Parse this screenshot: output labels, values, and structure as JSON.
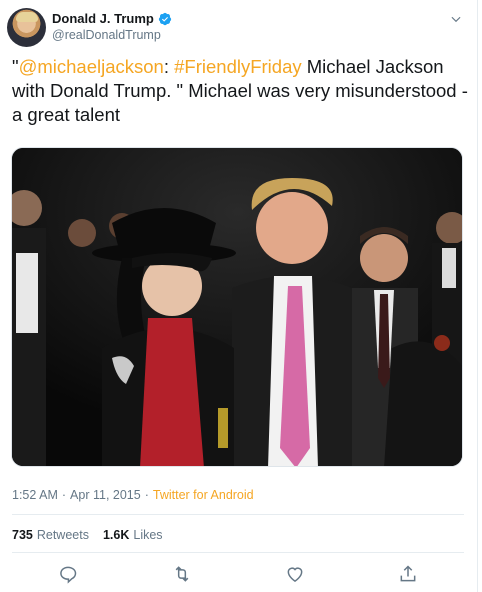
{
  "author": {
    "display_name": "Donald J. Trump",
    "handle": "@realDonaldTrump",
    "verified": true
  },
  "tweet": {
    "prefix": "\"",
    "mention": "@michaeljackson",
    "colon": ": ",
    "hashtag": "#FriendlyFriday",
    "body": " Michael Jackson with Donald Trump. \" Michael was very misunderstood - a great talent"
  },
  "meta": {
    "time": "1:52 AM",
    "separator": "·",
    "date": "Apr 11, 2015",
    "source": "Twitter for Android"
  },
  "stats": {
    "retweets_count": "735",
    "retweets_label": "Retweets",
    "likes_count": "1.6K",
    "likes_label": "Likes"
  },
  "colors": {
    "link": "#f5a623",
    "verified": "#1da1f2",
    "secondary_text": "#657786",
    "divider": "#e6ecf0"
  },
  "icons": [
    "verified-icon",
    "chevron-down-icon",
    "reply-icon",
    "retweet-icon",
    "like-icon",
    "share-icon"
  ]
}
